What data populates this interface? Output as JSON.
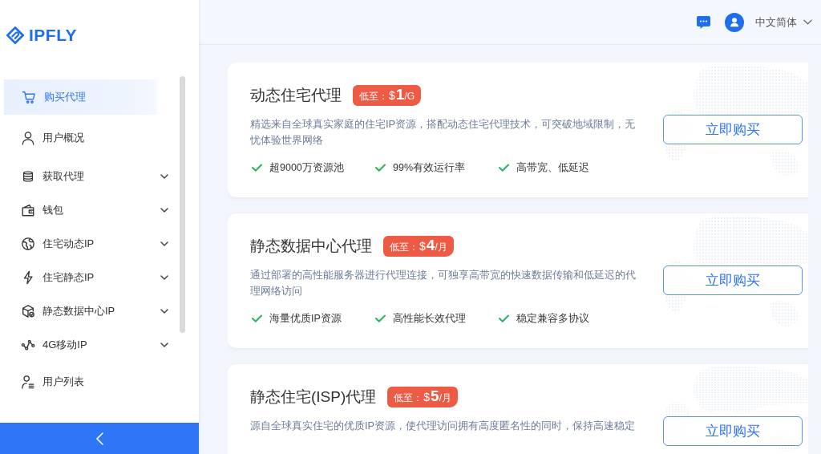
{
  "sidebar": {
    "logo": "IPFLY",
    "items": [
      {
        "label": "购买代理",
        "kind": "link",
        "selected": true
      },
      {
        "label": "用户概况",
        "kind": "link",
        "selected": false
      },
      {
        "label": "获取代理",
        "kind": "group",
        "selected": false
      },
      {
        "label": "钱包",
        "kind": "group",
        "selected": false
      },
      {
        "label": "住宅动态IP",
        "kind": "group",
        "selected": false
      },
      {
        "label": "住宅静态IP",
        "kind": "group",
        "selected": false
      },
      {
        "label": "静态数据中心IP",
        "kind": "group",
        "selected": false
      },
      {
        "label": "4G移动IP",
        "kind": "group",
        "selected": false
      },
      {
        "label": "用户列表",
        "kind": "link",
        "selected": false
      }
    ]
  },
  "header": {
    "language": "中文简体"
  },
  "products": [
    {
      "title": "动态住宅代理",
      "price": {
        "prefix": "低至：",
        "currency": "$",
        "amount": "1",
        "unit": "/G"
      },
      "description": "精选来自全球真实家庭的住宅IP资源，搭配动态住宅代理技术，可突破地域限制，无忧体验世界网络",
      "button": "立即购买",
      "features": [
        "超9000万资源池",
        "99%有效运行率",
        "高带宽、低延迟"
      ]
    },
    {
      "title": "静态数据中心代理",
      "price": {
        "prefix": "低至：",
        "currency": "$",
        "amount": "4",
        "unit": "/月"
      },
      "description": "通过部署的高性能服务器进行代理连接，可独享高带宽的快速数据传输和低延迟的代理网络访问",
      "button": "立即购买",
      "features": [
        "海量优质IP资源",
        "高性能长效代理",
        "稳定兼容多协议"
      ]
    },
    {
      "title": "静态住宅(ISP)代理",
      "price": {
        "prefix": "低至：",
        "currency": "$",
        "amount": "5",
        "unit": "/月"
      },
      "description": "源自全球真实住宅的优质IP资源，使代理访问拥有高度匿名性的同时，保持高速稳定",
      "button": "立即购买"
    }
  ]
}
